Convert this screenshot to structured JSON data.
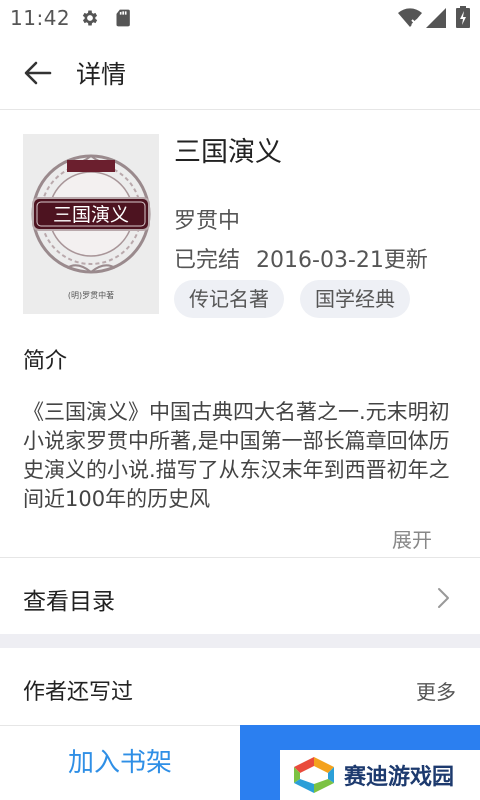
{
  "status_bar": {
    "time": "11:42",
    "icons": [
      "gear-icon",
      "sd-card-icon",
      "wifi-icon",
      "signal-icon",
      "battery-icon"
    ]
  },
  "app_bar": {
    "title": "详情",
    "back_icon": "arrow-left-icon"
  },
  "book": {
    "title": "三国演义",
    "author": "罗贯中",
    "status": "已完结",
    "updated": "2016-03-21更新",
    "tags": [
      "传记名著",
      "国学经典"
    ],
    "cover": {
      "title": "三国演义",
      "author_line": "(明)罗贯中著"
    }
  },
  "intro": {
    "heading": "简介",
    "text": "《三国演义》中国古典四大名著之一.元末明初小说家罗贯中所著,是中国第一部长篇章回体历史演义的小说.描写了从东汉末年到西晋初年之间近100年的历史风",
    "expand_label": "展开"
  },
  "catalog": {
    "label": "查看目录",
    "icon": "chevron-right-icon"
  },
  "author_also": {
    "title": "作者还写过",
    "more_label": "更多"
  },
  "bottom_bar": {
    "add_shelf_label": "加入书架"
  },
  "watermark": {
    "text": "赛迪游戏园"
  },
  "colors": {
    "accent": "#2b7ff0",
    "link_blue": "#2f8fe6",
    "tag_bg": "#eef0f5",
    "section_gap": "#eeeef3"
  }
}
